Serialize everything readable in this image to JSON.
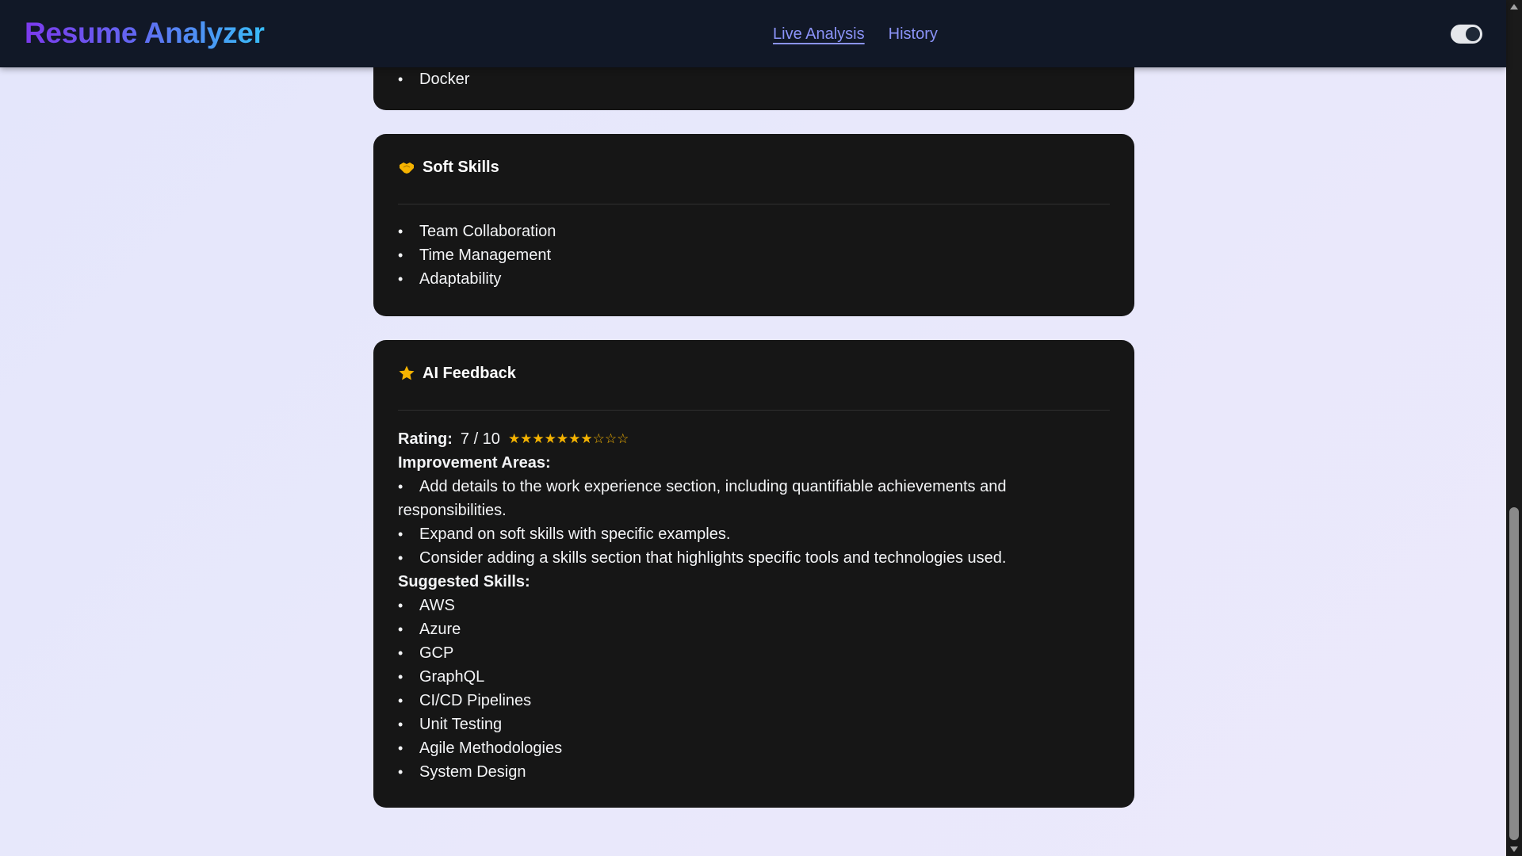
{
  "header": {
    "app_title": "Resume Analyzer",
    "nav": [
      {
        "label": "Live Analysis",
        "active": true
      },
      {
        "label": "History",
        "active": false
      }
    ],
    "theme_toggle_on": true
  },
  "tech_card": {
    "items": [
      "Docker"
    ]
  },
  "soft_skills": {
    "icon": "handshake-icon",
    "title": "Soft Skills",
    "items": [
      "Team Collaboration",
      "Time Management",
      "Adaptability"
    ]
  },
  "ai_feedback": {
    "icon": "star-icon",
    "title": "AI Feedback",
    "rating_label": "Rating:",
    "rating_value": "7 / 10",
    "rating_stars": "★★★★★★★☆☆☆",
    "rating": 7,
    "rating_max": 10,
    "improvement_title": "Improvement Areas:",
    "improvements": [
      "Add details to the work experience section, including quantifiable achievements and responsibilities.",
      "Expand on soft skills with specific examples.",
      "Consider adding a skills section that highlights specific tools and technologies used."
    ],
    "suggested_title": "Suggested Skills:",
    "suggested_skills": [
      "AWS",
      "Azure",
      "GCP",
      "GraphQL",
      "CI/CD Pipelines",
      "Unit Testing",
      "Agile Methodologies",
      "System Design"
    ]
  },
  "colors": {
    "navbar_bg": "#111827",
    "card_bg": "#161616",
    "nav_link": "#8b93f8",
    "star": "#f5b301"
  }
}
